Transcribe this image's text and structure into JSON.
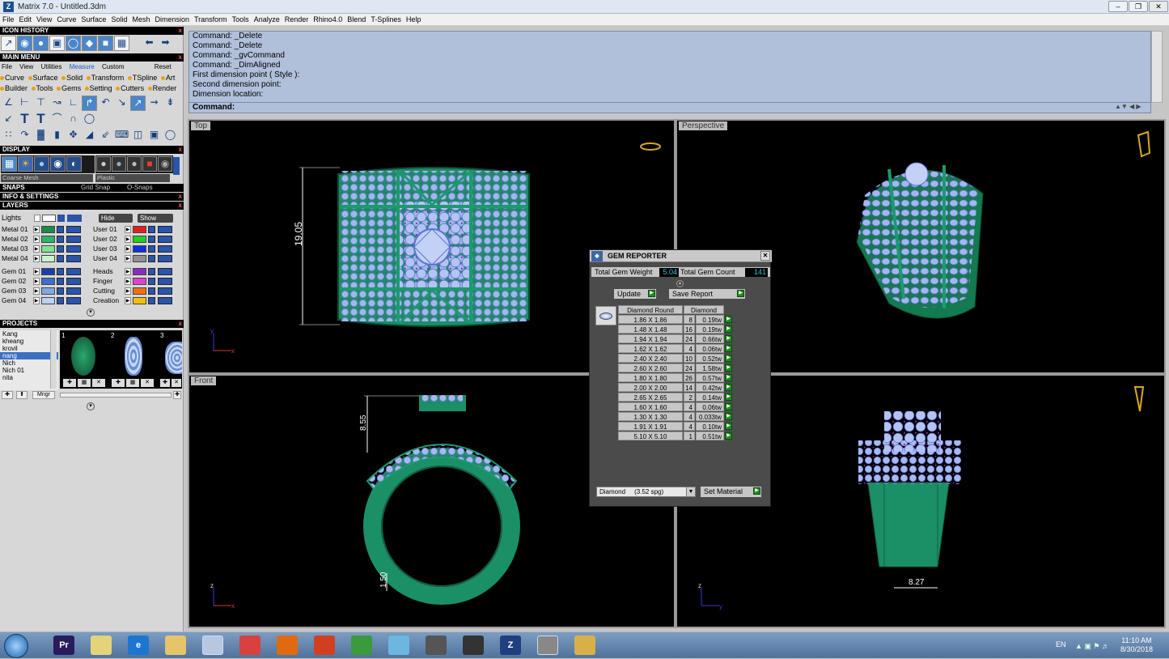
{
  "window": {
    "title": "Matrix 7.0 - Untitled.3dm",
    "logo": "Z"
  },
  "menu": [
    "File",
    "Edit",
    "View",
    "Curve",
    "Surface",
    "Solid",
    "Mesh",
    "Dimension",
    "Transform",
    "Tools",
    "Analyze",
    "Render",
    "Rhino4.0",
    "Blend",
    "T-Splines",
    "Help"
  ],
  "left": {
    "icon_history": "ICON HISTORY",
    "main_menu": "MAIN MENU",
    "tabs": [
      "File",
      "View",
      "Utilities",
      "Measure",
      "Custom",
      "Reset"
    ],
    "cats1": [
      "Curve",
      "Surface",
      "Solid",
      "Transform",
      "TSpline",
      "Art"
    ],
    "cats2": [
      "Builder",
      "Tools",
      "Gems",
      "Setting",
      "Cutters",
      "Render"
    ],
    "text_icon": "T",
    "display": "DISPLAY",
    "display_mode": "Coarse Mesh",
    "display_material": "Plastic",
    "snaps": "SNAPS",
    "grid_snap": "Grid Snap",
    "o_snaps": "O-Snaps",
    "info": "INFO & SETTINGS",
    "layers": "LAYERS",
    "lights": "Lights",
    "hide": "Hide",
    "show": "Show",
    "metal_layers": [
      {
        "name": "Metal 01",
        "color": "#1b8a4c"
      },
      {
        "name": "Metal 02",
        "color": "#2db36a"
      },
      {
        "name": "Metal 03",
        "color": "#7fe38f"
      },
      {
        "name": "Metal 04",
        "color": "#c9f3c8"
      }
    ],
    "user_layers": [
      {
        "name": "User 01",
        "color": "#e02020"
      },
      {
        "name": "User 02",
        "color": "#20d020"
      },
      {
        "name": "User 03",
        "color": "#1030e0"
      },
      {
        "name": "User 04",
        "color": "#909090"
      }
    ],
    "gem_layers": [
      {
        "name": "Gem 01",
        "color": "#1a3fa8"
      },
      {
        "name": "Gem 02",
        "color": "#3a6fd0"
      },
      {
        "name": "Gem 03",
        "color": "#7ea8e8"
      },
      {
        "name": "Gem 04",
        "color": "#b9d2f5"
      }
    ],
    "misc_layers": [
      {
        "name": "Heads",
        "color": "#8a2bbf"
      },
      {
        "name": "Finger",
        "color": "#e040d0"
      },
      {
        "name": "Cutting",
        "color": "#f07010"
      },
      {
        "name": "Creation",
        "color": "#f0c010"
      }
    ],
    "projects": "PROJECTS",
    "project_names": [
      "Kang",
      "kheang",
      "krovil",
      "nang",
      "Nich",
      "Nich 01",
      "nita"
    ],
    "project_thumbs": [
      "1",
      "2",
      "3"
    ],
    "mngr": "Mngr"
  },
  "command": {
    "lines": [
      "Command: _Delete",
      "Command: _Delete",
      "Command: _gvCommand",
      "Command: _DimAligned",
      "First dimension point ( Style ):",
      "Second dimension point:",
      "Dimension location:"
    ],
    "prompt": "Command:"
  },
  "viewports": {
    "top": "Top",
    "perspective": "Perspective",
    "front": "Front",
    "dim_top": "19.05",
    "dim_front_height": "8.55",
    "dim_front_band": "1.50",
    "dim_right": "8.27",
    "axis_x": "x",
    "axis_y": "y",
    "axis_z": "z"
  },
  "gem_reporter": {
    "title": "GEM REPORTER",
    "total_weight_label": "Total Gem Weight",
    "total_weight": "5.04",
    "total_count_label": "Total Gem Count",
    "total_count": "141",
    "update": "Update",
    "save": "Save Report",
    "col1": "Diamond Round",
    "col2": "Diamond",
    "rows": [
      {
        "size": "1.86 X 1.86",
        "qty": "8",
        "ct": "0.19tw"
      },
      {
        "size": "1.48 X 1.48",
        "qty": "16",
        "ct": "0.19tw"
      },
      {
        "size": "1.94 X 1.94",
        "qty": "24",
        "ct": "0.66tw"
      },
      {
        "size": "1.62 X 1.62",
        "qty": "4",
        "ct": "0.06tw"
      },
      {
        "size": "2.40 X 2.40",
        "qty": "10",
        "ct": "0.52tw"
      },
      {
        "size": "2.60 X 2.60",
        "qty": "24",
        "ct": "1.58tw"
      },
      {
        "size": "1.80 X 1.80",
        "qty": "26",
        "ct": "0.57tw"
      },
      {
        "size": "2.00 X 2.00",
        "qty": "14",
        "ct": "0.42tw"
      },
      {
        "size": "2.65 X 2.65",
        "qty": "2",
        "ct": "0.14tw"
      },
      {
        "size": "1.60 X 1.60",
        "qty": "4",
        "ct": "0.06tw"
      },
      {
        "size": "1.30 X 1.30",
        "qty": "4",
        "ct": "0.033tw"
      },
      {
        "size": "1.91 X 1.91",
        "qty": "4",
        "ct": "0.10tw"
      },
      {
        "size": "5.10 X 5.10",
        "qty": "1",
        "ct": "0.51tw"
      }
    ],
    "material": "Diamond     (3.52 spg)",
    "set_material": "Set Material"
  },
  "taskbar": {
    "apps": [
      "Pr",
      "",
      "e",
      "",
      "",
      "",
      "",
      "",
      "",
      "",
      "",
      "",
      "Z",
      "",
      ""
    ],
    "lang": "EN",
    "time": "11:10 AM",
    "date": "8/30/2018"
  }
}
